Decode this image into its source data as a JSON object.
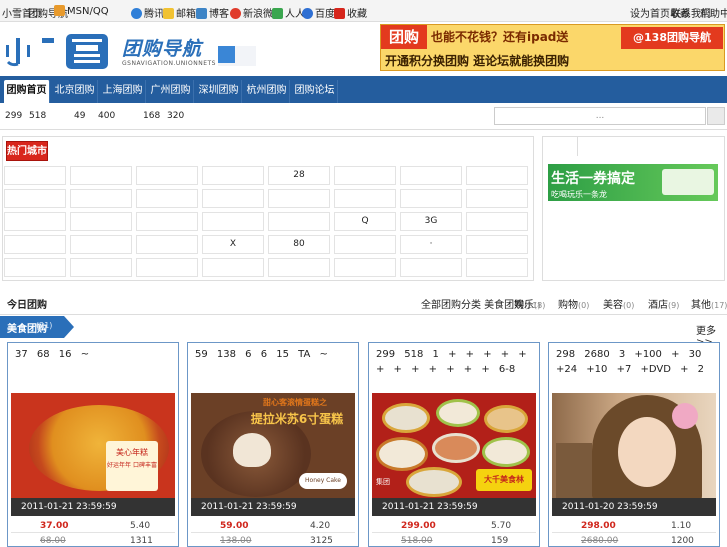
{
  "topbar": {
    "left_items": [
      "小雪首页",
      "团购导航",
      "MSN/QQ",
      "腾讯",
      "邮箱",
      "博客",
      "新浪微博",
      "人人",
      "百度",
      "收藏"
    ],
    "right_items": [
      "设为首页收藏",
      "联系我们",
      "帮助中心"
    ]
  },
  "header": {
    "logo_chars": "小雪",
    "logo_text": "团购导航",
    "logo_sub": "GSNAVIGATION.UNIONNETS",
    "banner": {
      "line1a": "团购",
      "line1b": "也能不花钱？还有ipad送",
      "line2": "开通积分换团购  逛论坛就能换团购",
      "brand": "@138团购导航",
      "brand_url": "tuan138.com"
    }
  },
  "nav": {
    "tabs": [
      "团购首页",
      "北京团购",
      "上海团购",
      "广州团购",
      "深圳团购",
      "杭州团购",
      "团购论坛"
    ]
  },
  "stats": {
    "a": "299",
    "b": "518",
    "c": "49",
    "d": "400",
    "e": "168",
    "f": "320",
    "search_placeholder": "..."
  },
  "city_panel": {
    "title": "热门城市团",
    "rows": [
      [
        "",
        "",
        "",
        "",
        "28",
        "",
        "",
        ""
      ],
      [
        "",
        "",
        "",
        "",
        "",
        "",
        "",
        ""
      ],
      [
        "",
        "",
        "",
        "",
        "",
        "Q",
        "3G",
        ""
      ],
      [
        "",
        "",
        "",
        "X",
        "80",
        "",
        "·",
        ""
      ],
      [
        "",
        "",
        "",
        "",
        "",
        "",
        "",
        ""
      ]
    ]
  },
  "side_ad": {
    "title": "生活一券搞定",
    "sub": "吃喝玩乐一条龙"
  },
  "section": {
    "title": "今日团购",
    "filters": [
      {
        "label": "全部团购分类 美食团购",
        "count": "(21)"
      },
      {
        "label": "娱乐",
        "count": "(8)"
      },
      {
        "label": "购物",
        "count": "(0)"
      },
      {
        "label": "美容",
        "count": "(0)"
      },
      {
        "label": "酒店",
        "count": "(9)"
      },
      {
        "label": "其他",
        "count": "(17)"
      }
    ],
    "category_tab": {
      "label": "美食团购",
      "count": "(21)"
    },
    "more": "更多>>"
  },
  "cards": [
    {
      "title": "37   68                                16               ~",
      "deadline": "2011-01-21 23:59:59",
      "price": "37.00",
      "discount": "5.40",
      "original": "68.00",
      "sold": "1311"
    },
    {
      "title": "59   138        6                  6      15                   TA   ~",
      "deadline": "2011-01-21 23:59:59",
      "price": "59.00",
      "discount": "4.20",
      "original": "138.00",
      "sold": "3125"
    },
    {
      "title": "299   518              1     +   +   +   +   +   +   +   +   +   +   +   +   6-8",
      "deadline": "2011-01-21 23:59:59",
      "price": "299.00",
      "discount": "5.70",
      "original": "518.00",
      "sold": "159"
    },
    {
      "title": "298   2680               3    +100   + 30 +24        +10    +7   +DVD   +  2",
      "deadline": "2011-01-20 23:59:59",
      "price": "298.00",
      "discount": "1.10",
      "original": "2680.00",
      "sold": "1200"
    }
  ],
  "image_texts": {
    "cake_label": "美心年糕",
    "cake_label2": "好运年年 口碑丰富",
    "tiramisu_label": "甜心客滚情蛋糕之",
    "tiramisu_label2": "提拉米苏6寸蛋糕",
    "tiramisu_brand": "Honey Cake",
    "feast_label": "大千美食林",
    "feast_label2": "集团"
  },
  "colors": {
    "nav_blue": "#245d9e",
    "accent_red": "#d0261c",
    "card_border": "#6c97c7",
    "tab_blue": "#2a6fb9"
  }
}
